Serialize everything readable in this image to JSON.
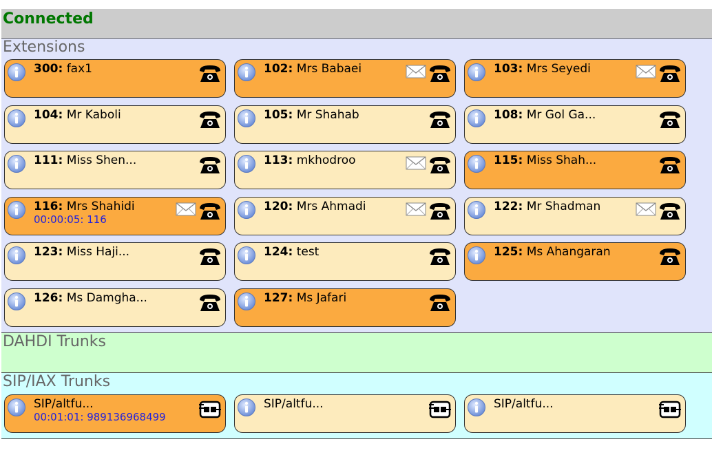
{
  "status": {
    "text": "Connected"
  },
  "extensions": {
    "title": "Extensions",
    "items": [
      {
        "number": "300",
        "name": "fax1",
        "busy": true,
        "mail": false,
        "sub": ""
      },
      {
        "number": "102",
        "name": "Mrs Babaei",
        "busy": true,
        "mail": true,
        "sub": ""
      },
      {
        "number": "103",
        "name": "Mrs Seyedi",
        "busy": true,
        "mail": true,
        "sub": ""
      },
      {
        "number": "104",
        "name": "Mr Kaboli",
        "busy": false,
        "mail": false,
        "sub": ""
      },
      {
        "number": "105",
        "name": "Mr Shahab",
        "busy": false,
        "mail": false,
        "sub": ""
      },
      {
        "number": "108",
        "name": "Mr Gol Ga...",
        "busy": false,
        "mail": false,
        "sub": ""
      },
      {
        "number": "111",
        "name": "Miss Shen...",
        "busy": false,
        "mail": false,
        "sub": ""
      },
      {
        "number": "113",
        "name": "mkhodroo",
        "busy": false,
        "mail": true,
        "sub": ""
      },
      {
        "number": "115",
        "name": "Miss Shah...",
        "busy": true,
        "mail": false,
        "sub": ""
      },
      {
        "number": "116",
        "name": "Mrs Shahidi",
        "busy": true,
        "mail": true,
        "sub": "00:00:05: 116"
      },
      {
        "number": "120",
        "name": "Mrs Ahmadi",
        "busy": false,
        "mail": true,
        "sub": ""
      },
      {
        "number": "122",
        "name": "Mr Shadman",
        "busy": false,
        "mail": true,
        "sub": ""
      },
      {
        "number": "123",
        "name": "Miss Haji...",
        "busy": false,
        "mail": false,
        "sub": ""
      },
      {
        "number": "124",
        "name": "test",
        "busy": false,
        "mail": false,
        "sub": ""
      },
      {
        "number": "125",
        "name": "Ms Ahangaran",
        "busy": true,
        "mail": false,
        "sub": ""
      },
      {
        "number": "126",
        "name": "Ms Damgha...",
        "busy": false,
        "mail": false,
        "sub": ""
      },
      {
        "number": "127",
        "name": "Ms Jafari",
        "busy": true,
        "mail": false,
        "sub": ""
      }
    ]
  },
  "dahdi": {
    "title": "DAHDI Trunks"
  },
  "sip": {
    "title": "SIP/IAX Trunks",
    "items": [
      {
        "name": "SIP/altfu...",
        "busy": true,
        "sub": "00:01:01: 989136968499"
      },
      {
        "name": "SIP/altfu...",
        "busy": false,
        "sub": ""
      },
      {
        "name": "SIP/altfu...",
        "busy": false,
        "sub": ""
      }
    ]
  },
  "colors": {
    "connected": "#007700",
    "busy_card": "#fbaa40",
    "idle_card": "#fdebbd",
    "extensions_bg": "#e0e4fb",
    "dahdi_bg": "#ceffce",
    "sip_bg": "#d0ffff",
    "call_text": "#2222dd"
  },
  "icons": [
    "info-icon",
    "phone-icon",
    "mail-icon",
    "trunk-icon"
  ]
}
